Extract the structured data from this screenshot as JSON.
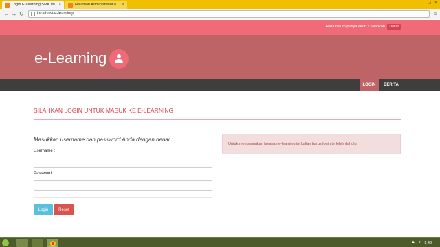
{
  "browser": {
    "tabs": [
      {
        "title": "Login E-Learning SMK Ini",
        "active": true
      },
      {
        "title": "Halaman Administrator e",
        "active": false
      }
    ],
    "url": "localhost/e-learning/"
  },
  "topbar": {
    "text": "Anda belum punya akun ? Silahkan",
    "daftar_label": "Daftar"
  },
  "banner": {
    "brand": "e-Learning",
    "avatar_icon": "user-icon"
  },
  "nav": {
    "items": [
      {
        "label": "LOGIN",
        "active": true
      },
      {
        "label": "BERITA",
        "active": false
      }
    ]
  },
  "main": {
    "heading": "SILAHKAN LOGIN UNTUK MASUK KE E-LEARNING",
    "instruction": "Masukkan username dan password Anda dengan benar :",
    "username_label": "Username :",
    "password_label": "Password :",
    "login_button": "Login",
    "reset_button": "Reset",
    "alert": "Untuk menggunakan layanan e-learning ini kalian harus login terlebih dahulu."
  },
  "taskbar": {
    "clock": "1:48"
  },
  "colors": {
    "topbar": "#f06a78",
    "banner": "#bf6466",
    "navbar": "#3e3e3e",
    "heading": "#d9434f",
    "login_button": "#5bc0de",
    "reset_button": "#d9534f"
  }
}
